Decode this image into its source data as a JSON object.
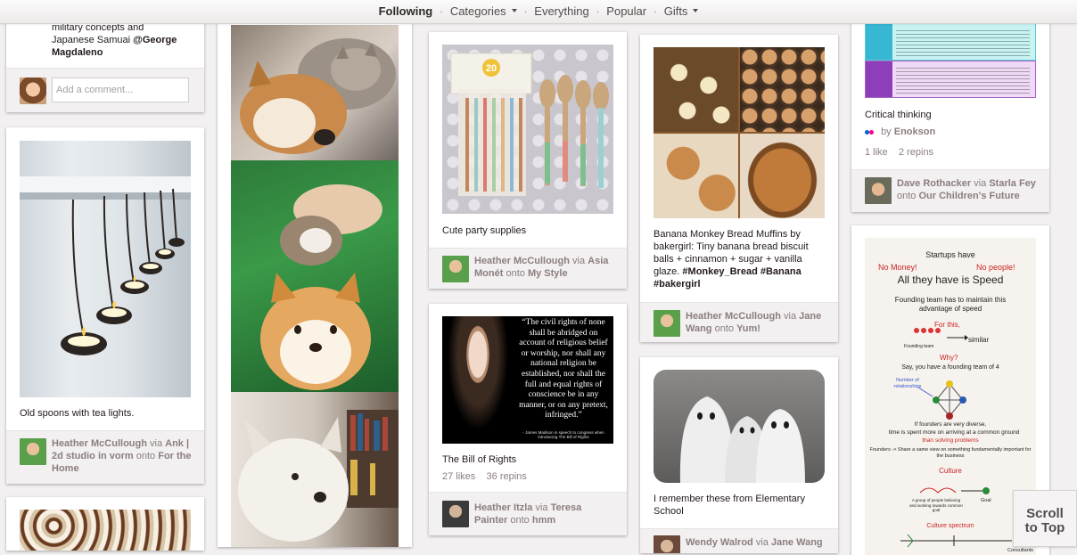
{
  "nav": {
    "following": "Following",
    "sep": "·",
    "categories": "Categories",
    "everything": "Everything",
    "popular": "Popular",
    "gifts": "Gifts"
  },
  "col1": {
    "top_desc_line1": "military concepts and",
    "top_desc_line2": "Japanese Samuai",
    "top_desc_mention": "@George Magdaleno",
    "comment_placeholder": "Add a comment...",
    "spoons": {
      "desc": "Old spoons with tea lights.",
      "user": "Heather McCullough",
      "via": "via",
      "via_user": "Ank | 2d studio in vorm",
      "onto": "onto",
      "board": "For the Home"
    }
  },
  "col3": {
    "party": {
      "desc": "Cute party supplies",
      "package_badge": "20",
      "user": "Heather McCullough",
      "via": "via",
      "via_user": "Asia Monét",
      "onto": "onto",
      "board": "My Style"
    },
    "rights": {
      "quote": "“The civil rights of none shall be abridged on account of religious belief or worship, nor shall any national religion be established, nor shall the full and equal rights of conscience be in any manner, or on any pretext, infringed.”",
      "attribution": "- James Madison in speech to congress when introducing The Bill of Rights",
      "desc": "The Bill of Rights",
      "likes": "27 likes",
      "repins": "36 repins",
      "user": "Heather Itzla",
      "via": "via",
      "via_user": "Teresa Painter",
      "onto": "onto",
      "board": "hmm"
    }
  },
  "col4": {
    "muffins": {
      "desc": "Banana Monkey Bread Muffins by bakergirl: Tiny banana bread biscuit balls + cinnamon + sugar + vanilla glaze.",
      "tags": "#Monkey_Bread #Banana #bakergirl",
      "user": "Heather McCullough",
      "via": "via",
      "via_user": "Jane Wang",
      "onto": "onto",
      "board": "Yum!"
    },
    "ghosts": {
      "desc": "I remember these from Elementary School",
      "user": "Wendy Walrod",
      "via": "via",
      "via_user": "Jane Wang"
    }
  },
  "col5": {
    "critical": {
      "desc": "Critical thinking",
      "by": "by",
      "source": "Enokson",
      "likes": "1 like",
      "repins": "2 repins",
      "user": "Dave Rothacker",
      "via": "via",
      "via_user": "Starla Fey",
      "onto": "onto",
      "board": "Our Children's Future"
    },
    "startups": {
      "title": "Startups have",
      "no_money": "No Money!",
      "no_people": "No people!",
      "speed": "All they have is Speed",
      "founding": "Founding team has to maintain this advantage of speed",
      "for_this": "For this,",
      "similar": "similar",
      "founding_team": "Founding team",
      "why": "Why?",
      "say": "Say, you have a founding team of 4",
      "num_rel": "Number of relationships",
      "diverse": "If founders are very diverse,",
      "time": "time is spent more on arriving at a common ground",
      "than": "than solving problems",
      "founders": "Founders -> Share a same view on something fundamentally important for the business",
      "culture": "Culture",
      "group": "A group of people believing and working towards common goal",
      "goal": "Goal",
      "spectrum": "Culture spectrum",
      "consultants": "Consultants"
    }
  },
  "scroll": {
    "line1": "Scroll",
    "line2": "to Top"
  },
  "colors": {
    "accent_gray": "#8c7e7e",
    "pin_bg": "#ffffff",
    "page_bg": "#f2f0f0",
    "red": "#cb2027"
  }
}
